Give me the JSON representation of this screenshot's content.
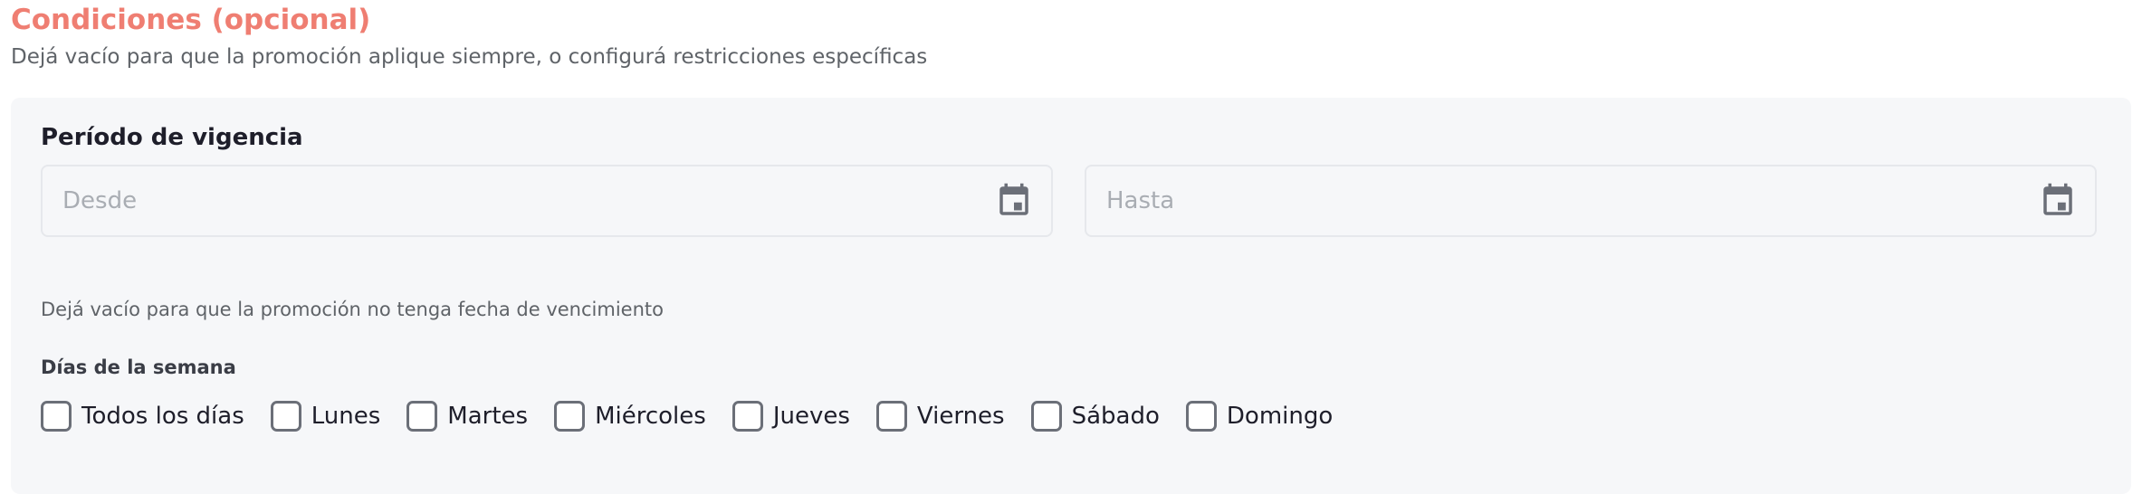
{
  "conditions": {
    "title": "Condiciones (opcional)",
    "description": "Dejá vacío para que la promoción aplique siempre, o configurá restricciones específicas"
  },
  "validity": {
    "label": "Período de vigencia",
    "from": {
      "placeholder": "Desde",
      "value": "",
      "icon": "calendar-icon"
    },
    "to": {
      "placeholder": "Hasta",
      "value": "",
      "icon": "calendar-icon"
    },
    "hint": "Dejá vacío para que la promoción no tenga fecha de vencimiento"
  },
  "weekdays": {
    "label": "Días de la semana",
    "options": [
      {
        "label": "Todos los días",
        "checked": false
      },
      {
        "label": "Lunes",
        "checked": false
      },
      {
        "label": "Martes",
        "checked": false
      },
      {
        "label": "Miércoles",
        "checked": false
      },
      {
        "label": "Jueves",
        "checked": false
      },
      {
        "label": "Viernes",
        "checked": false
      },
      {
        "label": "Sábado",
        "checked": false
      },
      {
        "label": "Domingo",
        "checked": false
      }
    ]
  },
  "colors": {
    "title": "#ef7e72",
    "panel_background": "#f6f7f9",
    "icon": "#6b6f78",
    "placeholder": "#a9adb3"
  }
}
